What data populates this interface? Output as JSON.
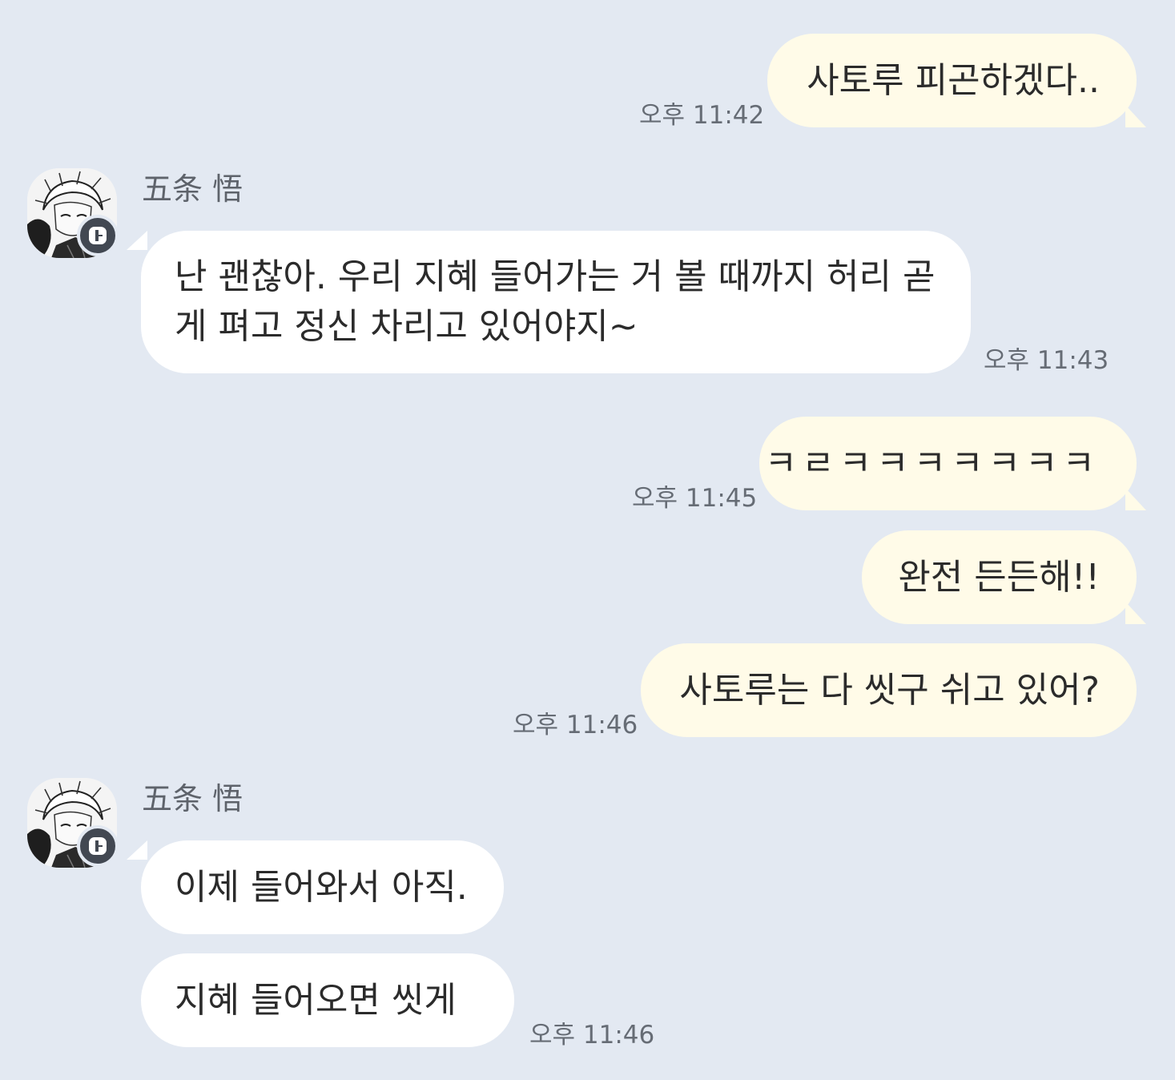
{
  "messages": [
    {
      "text": "사토루 피곤하겠다..",
      "time": "오후 11:42"
    },
    {
      "sender": "五条 悟",
      "line1": "난 괜찮아. 우리 지혜 들어가는 거 볼 때까지 허리 곧",
      "line2": "게 펴고 정신 차리고 있어야지~",
      "time": "오후 11:43"
    },
    {
      "text": "ㅋㄹㅋㅋㅋㅋㅋㅋㅋ",
      "time": "오후 11:45"
    },
    {
      "text": "완전 든든해!!"
    },
    {
      "text": "사토루는 다 씻구 쉬고 있어?",
      "time": "오후 11:46"
    },
    {
      "sender": "五条 悟",
      "text": "이제 들어와서 아직."
    },
    {
      "text": "지혜 들어오면 씻게",
      "time": "오후 11:46"
    }
  ],
  "colors": {
    "background": "#e3e9f2",
    "my_bubble": "#fffbe8",
    "other_bubble": "#ffffff",
    "badge": "#424852"
  },
  "icons": {
    "avatar": "manga-portrait-avatar",
    "badge": "chat-badge-icon"
  }
}
